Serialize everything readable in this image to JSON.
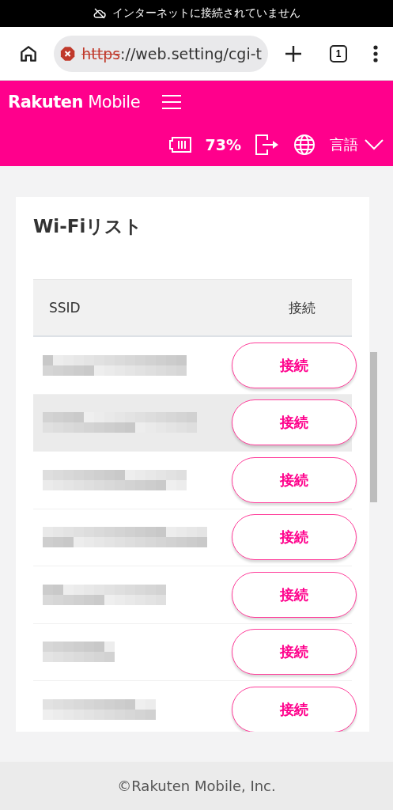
{
  "status_bar": {
    "message": "インターネットに接続されていません"
  },
  "browser": {
    "url_scheme": "https",
    "url_rest": "://web.setting/cgi-t",
    "tab_count": "1"
  },
  "header": {
    "logo_bold": "Rakuten",
    "logo_light": "Mobile",
    "battery": "73%",
    "language": "言語"
  },
  "wifi_list": {
    "title": "Wi-Fiリスト",
    "columns": [
      "SSID",
      "接続"
    ],
    "rows": [
      {
        "button": "接続",
        "selected": false
      },
      {
        "button": "接続",
        "selected": true
      },
      {
        "button": "接続",
        "selected": false
      },
      {
        "button": "接続",
        "selected": false
      },
      {
        "button": "接続",
        "selected": false
      },
      {
        "button": "接続",
        "selected": false
      },
      {
        "button": "接続",
        "selected": false
      }
    ]
  },
  "footer": {
    "copyright": "©Rakuten Mobile, Inc."
  }
}
